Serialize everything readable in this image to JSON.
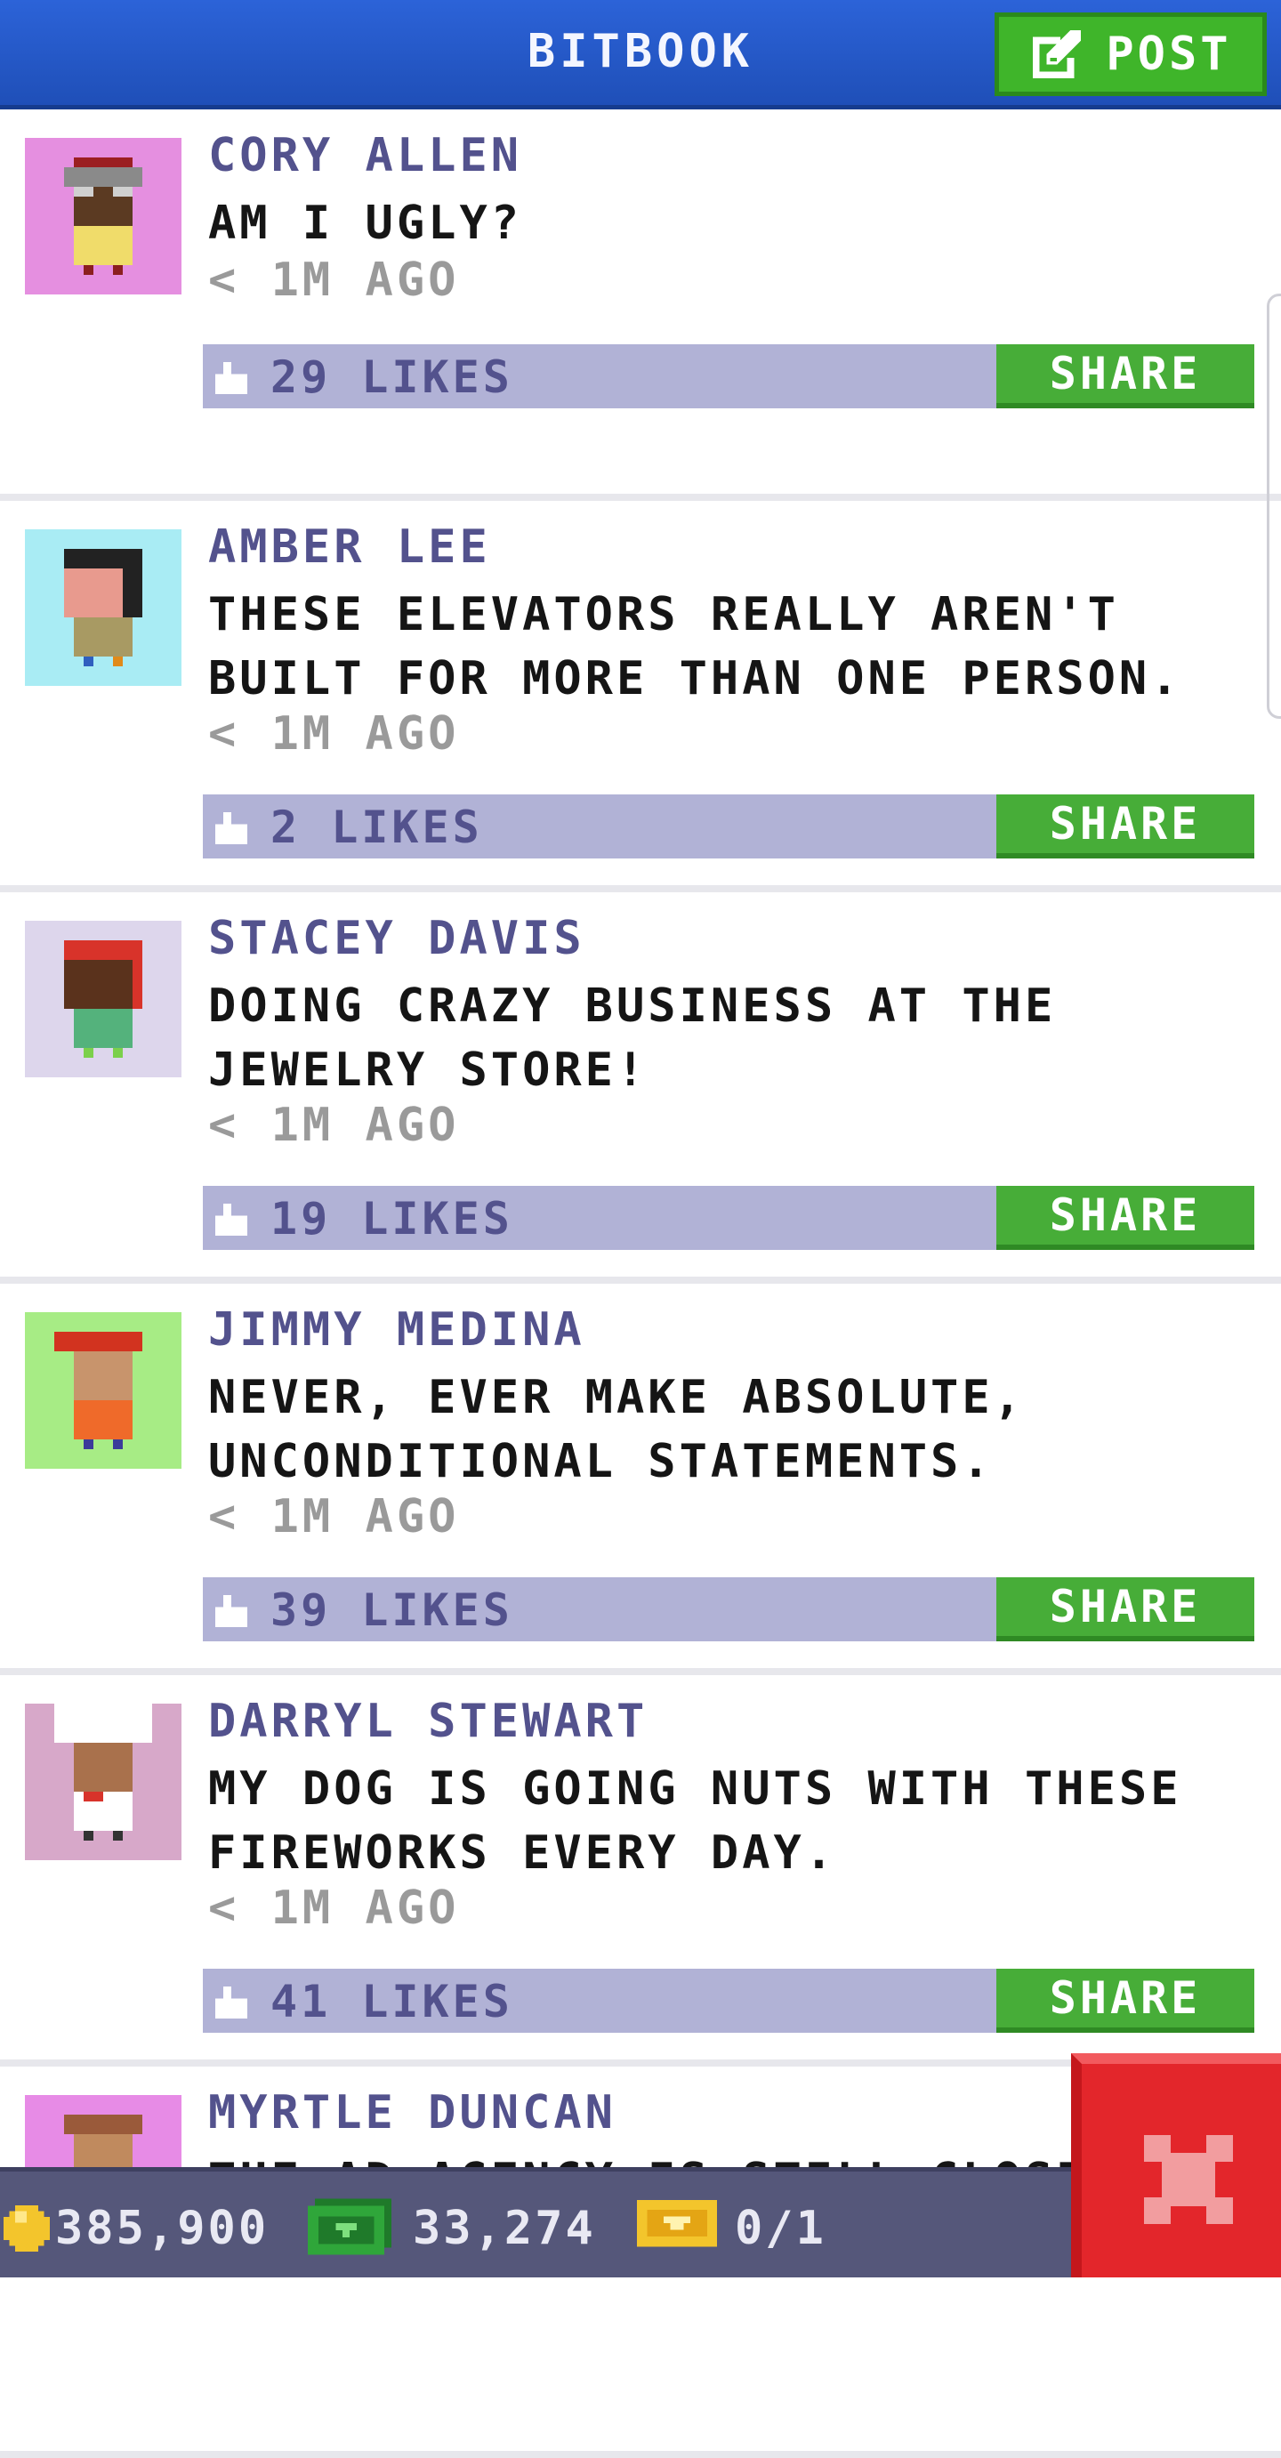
{
  "header": {
    "title": "BITBOOK",
    "post_label": "POST"
  },
  "share_label": "SHARE",
  "posts": [
    {
      "author": "CORY ALLEN",
      "message": "AM I UGLY?",
      "time": "< 1M AGO",
      "likes": "29 LIKES",
      "avatar_bg": "#e58fe0"
    },
    {
      "author": "AMBER LEE",
      "message": "THESE ELEVATORS REALLY AREN'T\nBUILT FOR MORE THAN ONE PERSON.",
      "time": "< 1M AGO",
      "likes": "2 LIKES",
      "avatar_bg": "#a9ecf4"
    },
    {
      "author": "STACEY DAVIS",
      "message": "DOING CRAZY BUSINESS AT THE\nJEWELRY STORE!",
      "time": "< 1M AGO",
      "likes": "19 LIKES",
      "avatar_bg": "#ddd6ec"
    },
    {
      "author": "JIMMY MEDINA",
      "message": "NEVER, EVER MAKE ABSOLUTE,\nUNCONDITIONAL STATEMENTS.",
      "time": "< 1M AGO",
      "likes": "39 LIKES",
      "avatar_bg": "#a7ec85"
    },
    {
      "author": "DARRYL STEWART",
      "message": "MY DOG IS GOING NUTS WITH THESE\nFIREWORKS EVERY DAY.",
      "time": "< 1M AGO",
      "likes": "41 LIKES",
      "avatar_bg": "#d7a8c9"
    },
    {
      "author": "MYRTLE DUNCAN",
      "message": "THE AD AGENCY IS STILL CLOSED",
      "avatar_bg": "#e78be6"
    }
  ],
  "status": {
    "coins": "385,900",
    "bux": "33,274",
    "tickets": "0/1"
  },
  "icons": [
    "edit-icon",
    "like-icon",
    "coin-icon",
    "bux-icon",
    "ticket-icon",
    "close-icon"
  ],
  "colors": {
    "header": "#2c63d8",
    "green": "#47ad38",
    "likebar": "#b1b2d6",
    "author": "#53528d",
    "close": "#e3262b"
  }
}
